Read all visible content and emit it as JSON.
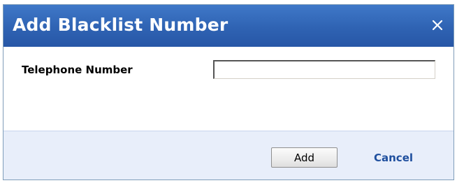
{
  "dialog": {
    "title": "Add Blacklist Number",
    "close_icon": "close-icon"
  },
  "form": {
    "telephone_label": "Telephone Number",
    "telephone_value": "",
    "telephone_placeholder": ""
  },
  "footer": {
    "add_label": "Add",
    "cancel_label": "Cancel"
  },
  "colors": {
    "titlebar": "#2f63b3",
    "footer_bg": "#e8eefa",
    "link": "#1f4f9e"
  }
}
